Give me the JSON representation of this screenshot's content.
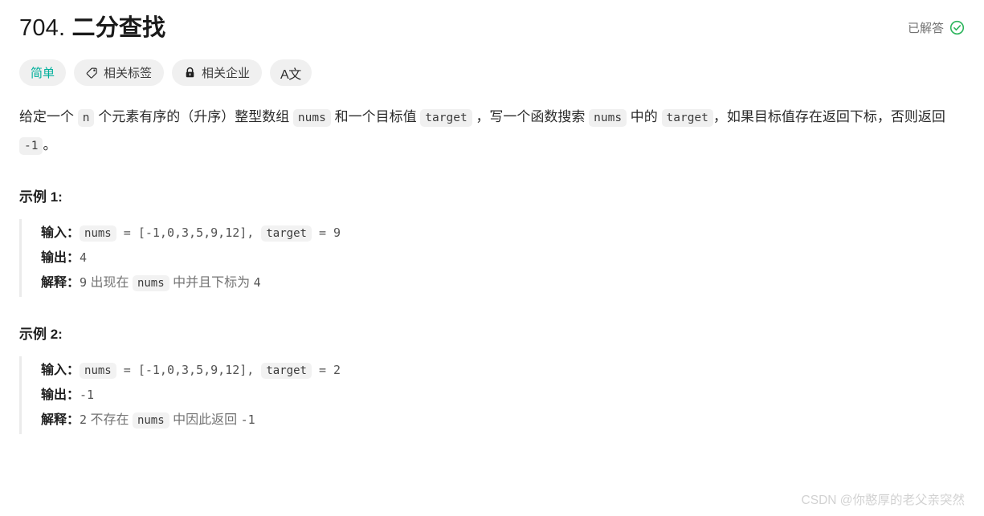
{
  "header": {
    "question_number": "704.",
    "title": "二分查找",
    "status_label": "已解答",
    "status_icon": "check-circle-icon",
    "status_color": "#2db55d"
  },
  "pills": [
    {
      "key": "difficulty",
      "label": "简单",
      "icon": null,
      "color": "#00af9b"
    },
    {
      "key": "topics",
      "label": "相关标签",
      "icon": "tag-icon"
    },
    {
      "key": "companies",
      "label": "相关企业",
      "icon": "lock-icon"
    },
    {
      "key": "language",
      "label": "A文",
      "icon": "language-toggle-icon"
    }
  ],
  "description": {
    "segments": [
      {
        "type": "text",
        "value": "给定一个 "
      },
      {
        "type": "code",
        "value": "n"
      },
      {
        "type": "text",
        "value": " 个元素有序的（升序）整型数组 "
      },
      {
        "type": "code",
        "value": "nums"
      },
      {
        "type": "text",
        "value": " 和一个目标值 "
      },
      {
        "type": "code",
        "value": "target"
      },
      {
        "type": "text",
        "value": " ，写一个函数搜索 "
      },
      {
        "type": "code",
        "value": "nums"
      },
      {
        "type": "text",
        "value": " 中的 "
      },
      {
        "type": "code",
        "value": "target"
      },
      {
        "type": "text",
        "value": "，如果目标值存在返回下标，否则返回 "
      },
      {
        "type": "code",
        "value": "-1"
      },
      {
        "type": "text",
        "value": "。"
      }
    ],
    "plain": "给定一个 n 个元素有序的（升序）整型数组 nums 和一个目标值 target ，写一个函数搜索 nums 中的 target，如果目标值存在返回下标，否则返回 -1 。"
  },
  "examples": [
    {
      "title": "示例 1:",
      "input_label": "输入：",
      "input_code_1": "nums",
      "input_eq_1": " = ",
      "input_value_1": "[-1,0,3,5,9,12], ",
      "input_code_2": "target",
      "input_eq_2": " = ",
      "input_value_2": "9",
      "output_label": "输出：",
      "output_value": "4",
      "explain_label": "解释：",
      "explain_pre_value": "9",
      "explain_pre_text": " 出现在 ",
      "explain_code": "nums",
      "explain_post_text": " 中并且下标为 ",
      "explain_post_value": "4"
    },
    {
      "title": "示例 2:",
      "input_label": "输入：",
      "input_code_1": "nums",
      "input_eq_1": " = ",
      "input_value_1": "[-1,0,3,5,9,12], ",
      "input_code_2": "target",
      "input_eq_2": " = ",
      "input_value_2": "2",
      "output_label": "输出：",
      "output_value": "-1",
      "explain_label": "解释：",
      "explain_pre_value": "2",
      "explain_pre_text": " 不存在 ",
      "explain_code": "nums",
      "explain_post_text": " 中因此返回 ",
      "explain_post_value": "-1"
    }
  ],
  "watermark": {
    "text": "CSDN @你憨厚的老父亲突然"
  }
}
